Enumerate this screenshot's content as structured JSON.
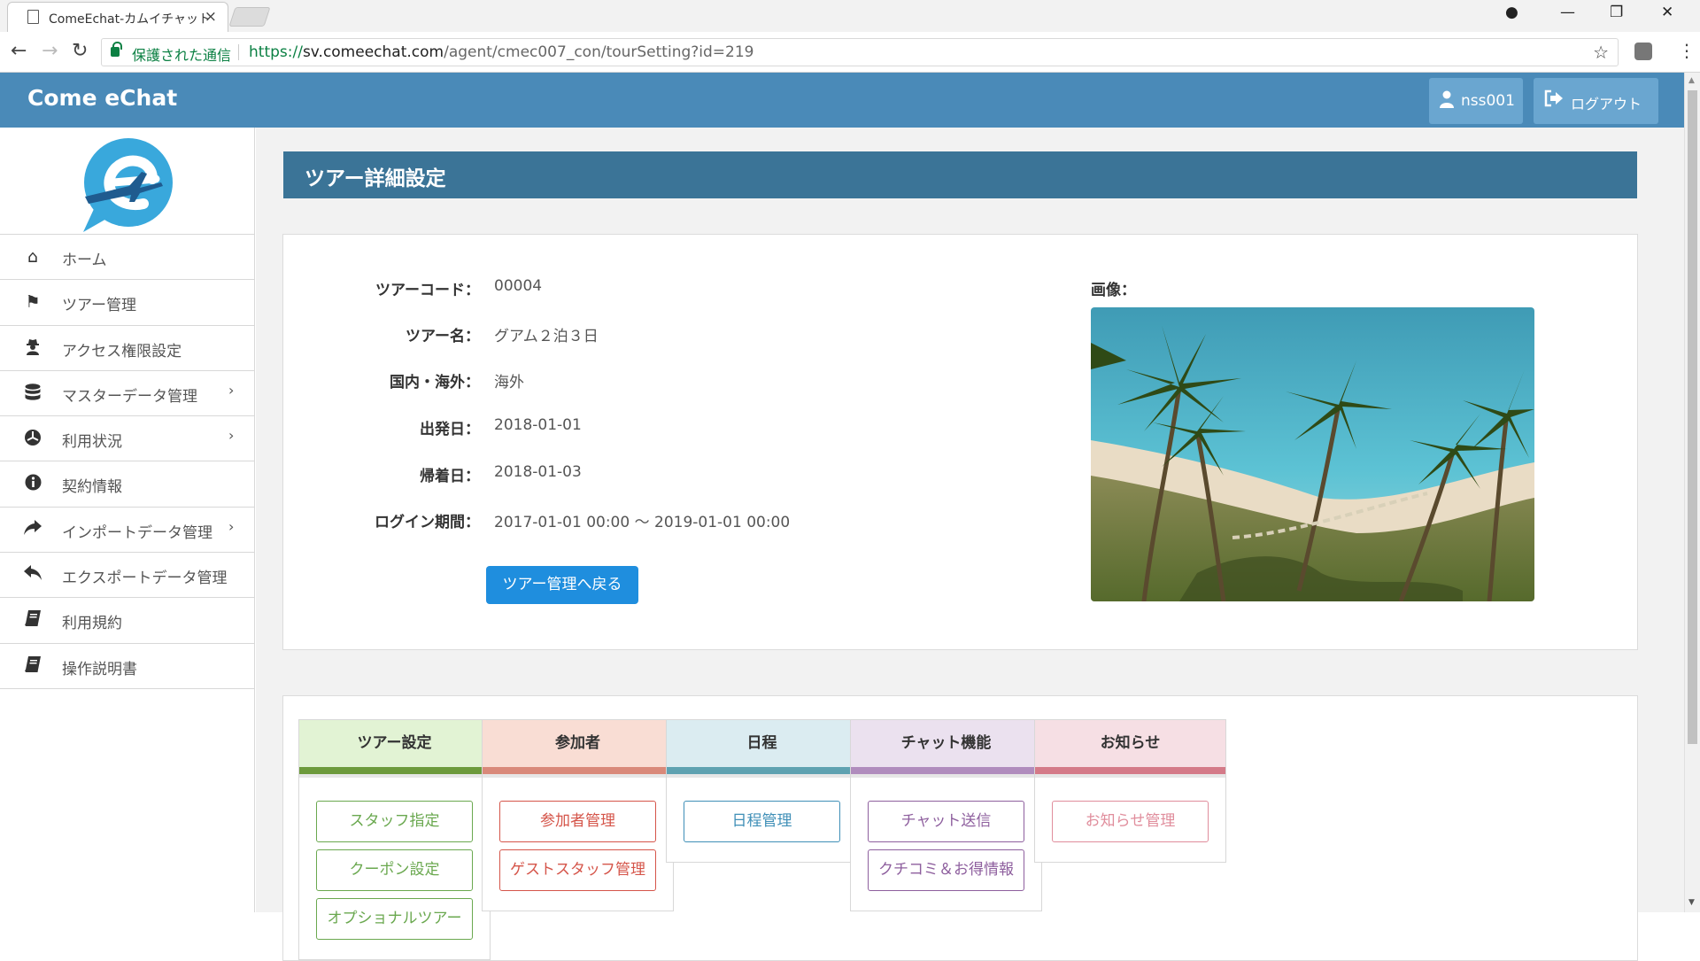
{
  "browser": {
    "tab_title": "ComeEchat-カムイチャット",
    "tab_close": "×",
    "secure_label": "保護された通信",
    "url_scheme": "https://",
    "url_host": "sv.comeechat.com",
    "url_path": "/agent/cmec007_con/tourSetting?id=219"
  },
  "header": {
    "brand": "Come eChat",
    "user_label": "nss001",
    "logout_label": "ログアウト",
    "accent_color": "#4a8ab8"
  },
  "sidebar": {
    "items": [
      {
        "label": "ホーム",
        "icon": "home-icon",
        "has_submenu": false
      },
      {
        "label": "ツアー管理",
        "icon": "flag-icon",
        "has_submenu": false
      },
      {
        "label": "アクセス権限設定",
        "icon": "user-secret-icon",
        "has_submenu": false
      },
      {
        "label": "マスターデータ管理",
        "icon": "database-icon",
        "has_submenu": true
      },
      {
        "label": "利用状況",
        "icon": "empire-icon",
        "has_submenu": true
      },
      {
        "label": "契約情報",
        "icon": "info-icon",
        "has_submenu": false
      },
      {
        "label": "インポートデータ管理",
        "icon": "share-icon",
        "has_submenu": true
      },
      {
        "label": "エクスポートデータ管理",
        "icon": "reply-icon",
        "has_submenu": false
      },
      {
        "label": "利用規約",
        "icon": "book-icon",
        "has_submenu": false
      },
      {
        "label": "操作説明書",
        "icon": "book-icon",
        "has_submenu": false
      }
    ]
  },
  "page": {
    "title": "ツアー詳細設定",
    "details": [
      {
        "key": "ツアーコード：",
        "value": "00004"
      },
      {
        "key": "ツアー名：",
        "value": "グアム２泊３日"
      },
      {
        "key": "国内・海外：",
        "value": "海外"
      },
      {
        "key": "出発日：",
        "value": "2018-01-01"
      },
      {
        "key": "帰着日：",
        "value": "2018-01-03"
      },
      {
        "key": "ログイン期間：",
        "value": "2017-01-01 00:00 〜 2019-01-01 00:00"
      }
    ],
    "back_button": "ツアー管理へ戻る",
    "image_label": "画像："
  },
  "modules": [
    {
      "title": "ツアー設定",
      "head_color": "#e2f3d4",
      "bar_color": "#6d9a3c",
      "btn_color": "#6aa84f",
      "buttons": [
        "スタッフ指定",
        "クーポン設定",
        "オプショナルツアー"
      ]
    },
    {
      "title": "参加者",
      "head_color": "#f9ddd4",
      "bar_color": "#d9897a",
      "btn_color": "#d5554a",
      "buttons": [
        "参加者管理",
        "ゲストスタッフ管理"
      ]
    },
    {
      "title": "日程",
      "head_color": "#dbecf1",
      "bar_color": "#5fa2b1",
      "btn_color": "#3f8fb7",
      "buttons": [
        "日程管理"
      ]
    },
    {
      "title": "チャット機能",
      "head_color": "#ebe1ef",
      "bar_color": "#b08cbd",
      "btn_color": "#8e5f9e",
      "buttons": [
        "チャット送信",
        "クチコミ＆お得情報"
      ]
    },
    {
      "title": "お知らせ",
      "head_color": "#f6dfe4",
      "bar_color": "#d47a88",
      "btn_color": "#e08d9c",
      "buttons": [
        "お知らせ管理"
      ]
    }
  ]
}
